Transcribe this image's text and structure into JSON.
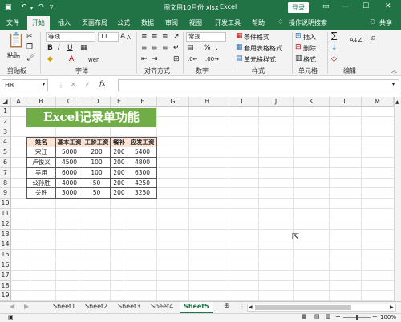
{
  "titlebar": {
    "filename": "图文用10月份.xlsx",
    "dash": "-",
    "app": "Excel",
    "login": "登录",
    "undo_icon": "↶",
    "redo_icon": "↷",
    "save_icon": "save-icon"
  },
  "tabs": [
    "文件",
    "开始",
    "插入",
    "页面布局",
    "公式",
    "数据",
    "审阅",
    "视图",
    "开发工具",
    "帮助",
    "操作说明搜索",
    "共享"
  ],
  "ribbon": {
    "clipboard": {
      "paste": "粘贴",
      "label": "剪贴板"
    },
    "font": {
      "name": "等线",
      "size": "11",
      "label": "字体",
      "bold": "B",
      "italic": "I",
      "underline": "U",
      "grow": "A",
      "shrink": "A",
      "font_color": "A",
      "fill": "◆",
      "wen": "wén",
      "border": "▦"
    },
    "align": {
      "label": "对齐方式"
    },
    "number": {
      "format": "常规",
      "label": "数字",
      "percent": "%",
      "comma": ",",
      "currency": "▤"
    },
    "styles": {
      "cond": "条件格式",
      "table": "套用表格格式",
      "cell": "单元格样式",
      "label": "样式"
    },
    "cells": {
      "insert": "插入",
      "delete": "删除",
      "format": "格式",
      "label": "单元格"
    },
    "edit": {
      "sum": "∑",
      "fill": "↓",
      "clear": "◇",
      "sort": "A↓Z",
      "find": "⌕",
      "label": "编辑"
    }
  },
  "formula_bar": {
    "name_box": "H8",
    "cancel": "✕",
    "enter": "✓",
    "fx": "fx",
    "value": ""
  },
  "columns": [
    "A",
    "B",
    "C",
    "D",
    "E",
    "F",
    "G",
    "H",
    "I",
    "J",
    "K",
    "L",
    "M"
  ],
  "rows": [
    "1",
    "2",
    "3",
    "4",
    "5",
    "6",
    "7",
    "8",
    "9",
    "10",
    "11",
    "12",
    "13",
    "14",
    "15",
    "16",
    "17",
    "18",
    "19"
  ],
  "sheet": {
    "banner": "Excel记录单功能",
    "headers": [
      "姓名",
      "基本工资",
      "工龄工资",
      "餐补",
      "应发工资"
    ],
    "records": [
      [
        "宋江",
        "5000",
        "200",
        "200",
        "5400"
      ],
      [
        "卢俊义",
        "4500",
        "100",
        "200",
        "4800"
      ],
      [
        "吴用",
        "6000",
        "100",
        "200",
        "6300"
      ],
      [
        "公孙胜",
        "4000",
        "50",
        "200",
        "4250"
      ],
      [
        "关胜",
        "3000",
        "50",
        "200",
        "3250"
      ]
    ]
  },
  "sheet_tabs": [
    "Sheet1",
    "Sheet2",
    "Sheet3",
    "Sheet4",
    "Sheet5"
  ],
  "active_sheet": "Sheet5",
  "status": {
    "zoom": "100%",
    "add_sheet": "⊕",
    "prev": "◀",
    "next": "▶",
    "minus": "−",
    "plus": "+"
  },
  "colors": {
    "brand": "#217346",
    "banner": "#70ad47",
    "header_fill": "#fbe3d6"
  }
}
